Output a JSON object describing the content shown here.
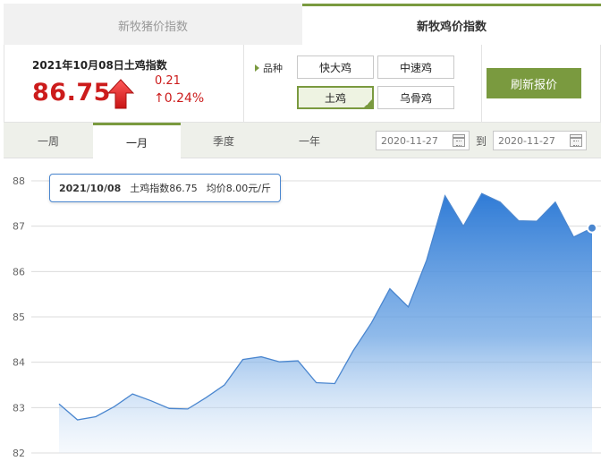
{
  "top_tabs": [
    {
      "label": "新牧猪价指数",
      "active": false
    },
    {
      "label": "新牧鸡价指数",
      "active": true
    }
  ],
  "price": {
    "title": "2021年10月08日土鸡指数",
    "value": "86.75",
    "change_abs": "0.21",
    "change_pct": "↑0.24%",
    "trend": "up"
  },
  "variety": {
    "label": "品种",
    "options": [
      "快大鸡",
      "中速鸡",
      "土鸡",
      "乌骨鸡"
    ],
    "selected": "土鸡"
  },
  "refresh_label": "刷新报价",
  "periods": [
    {
      "label": "一周",
      "active": false
    },
    {
      "label": "一月",
      "active": true
    },
    {
      "label": "季度",
      "active": false
    },
    {
      "label": "一年",
      "active": false
    }
  ],
  "date_range": {
    "from": "2020-11-27",
    "to_label": "到",
    "to": "2020-11-27"
  },
  "tooltip": {
    "date": "2021/10/08",
    "index": "土鸡指数86.75",
    "avg": "均价8.00元/斤"
  },
  "colors": {
    "accent": "#7a9a3f",
    "price_red": "#cc1c1c",
    "line": "#4a86cf"
  },
  "chart_data": {
    "type": "area",
    "ylim": [
      82,
      88
    ],
    "yticks": [
      "82",
      "83",
      "84",
      "85",
      "86",
      "87",
      "88"
    ],
    "values": [
      83.08,
      82.73,
      82.8,
      83.02,
      83.3,
      83.15,
      82.98,
      82.97,
      83.22,
      83.5,
      84.06,
      84.12,
      84.01,
      84.03,
      83.55,
      83.53,
      84.25,
      84.87,
      85.62,
      85.22,
      86.25,
      87.67,
      87.0,
      87.72,
      87.53,
      87.12,
      87.11,
      87.53,
      86.76,
      86.96
    ],
    "highlight_index": 29
  }
}
